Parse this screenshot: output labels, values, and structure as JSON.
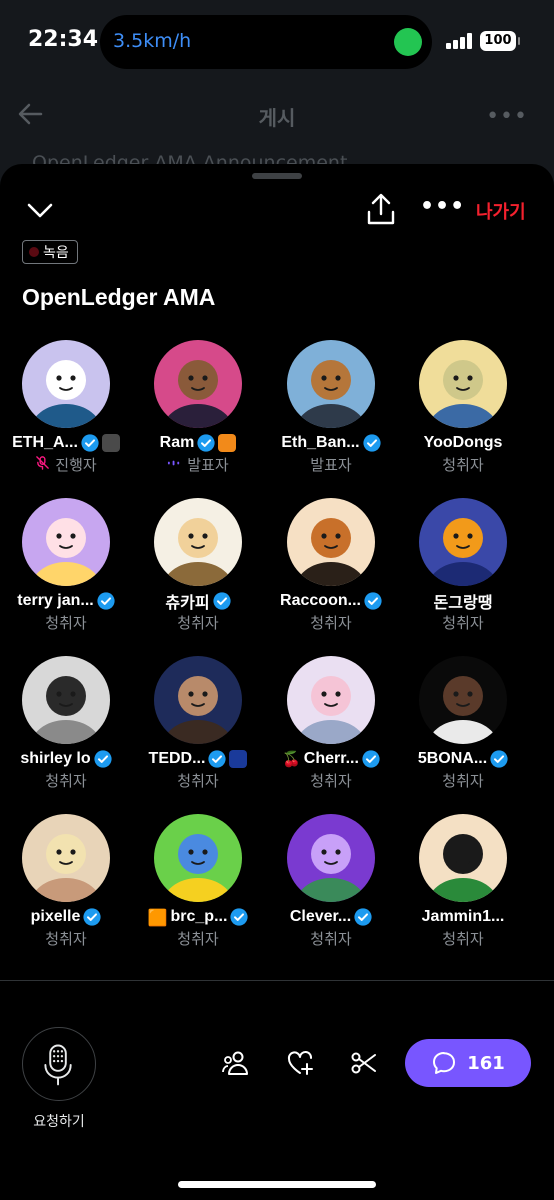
{
  "status_bar": {
    "time": "22:34",
    "speed": "3.5km/h",
    "battery": "100"
  },
  "background_page": {
    "title": "게시",
    "snippet": "OpenLedger AMA Announcement"
  },
  "header": {
    "leave_label": "나가기"
  },
  "space": {
    "recording_label": "녹음",
    "title": "OpenLedger AMA"
  },
  "participants": [
    {
      "name": "ETH_A...",
      "role": "진행자",
      "verified": true,
      "avatar_icon": "penguin-avatar-icon",
      "colors": [
        "#c9c3ee",
        "#ffffff",
        "#1f5a8a"
      ]
    },
    {
      "name": "Ram",
      "role": "발표자",
      "verified": true,
      "avatar_icon": "man-portrait-avatar-icon",
      "colors": [
        "#d64a8a",
        "#8a5a3a",
        "#2a1f3a"
      ]
    },
    {
      "name": "Eth_Ban...",
      "role": "발표자",
      "verified": true,
      "avatar_icon": "bear-king-avatar-icon",
      "colors": [
        "#7fb0d8",
        "#b5763a",
        "#2e3a4a"
      ]
    },
    {
      "name": "YooDongs",
      "role": "청취자",
      "verified": false,
      "avatar_icon": "yoodongs-nft-avatar-icon",
      "colors": [
        "#f0dd9a",
        "#cfc88a",
        "#3b6aa5"
      ]
    },
    {
      "name": "terry jan...",
      "role": "청취자",
      "verified": true,
      "avatar_icon": "cartoon-boy-avatar-icon",
      "colors": [
        "#c7a6f0",
        "#ffe0e6",
        "#ffd56a"
      ]
    },
    {
      "name": "츄카피",
      "role": "청취자",
      "verified": true,
      "avatar_icon": "powerpuff-girl-avatar-icon",
      "colors": [
        "#f5f0e4",
        "#f1d19a",
        "#8b6a3a"
      ]
    },
    {
      "name": "Raccoon...",
      "role": "청취자",
      "verified": true,
      "avatar_icon": "raccoon-avatar-icon",
      "colors": [
        "#f6e0c4",
        "#c8702a",
        "#2a2018"
      ]
    },
    {
      "name": "돈그랑땡",
      "role": "청취자",
      "verified": false,
      "avatar_icon": "orange-blob-avatar-icon",
      "colors": [
        "#3a48a8",
        "#f29a1a",
        "#1c2a74"
      ]
    },
    {
      "name": "shirley lo",
      "role": "청취자",
      "verified": true,
      "avatar_icon": "woman-photo-avatar-icon",
      "colors": [
        "#d8d8d8",
        "#2a2a2a",
        "#8a8a8a"
      ]
    },
    {
      "name": "TEDD...",
      "role": "청취자",
      "verified": true,
      "avatar_icon": "group-photo-avatar-icon",
      "colors": [
        "#1e2b5a",
        "#b88a6a",
        "#3a2a22"
      ]
    },
    {
      "name": "Cherr...",
      "role": "청취자",
      "verified": true,
      "avatar_icon": "anime-girl-avatar-icon",
      "colors": [
        "#eadff2",
        "#f5c4d6",
        "#9aa8c8"
      ]
    },
    {
      "name": "5BONA...",
      "role": "청취자",
      "verified": true,
      "avatar_icon": "dark-mask-avatar-icon",
      "colors": [
        "#0a0a0a",
        "#5a3a2a",
        "#eaeaea"
      ]
    },
    {
      "name": "pixelle",
      "role": "청취자",
      "verified": true,
      "avatar_icon": "blonde-woman-avatar-icon",
      "colors": [
        "#e8d4b8",
        "#f2e2b0",
        "#c89a7a"
      ]
    },
    {
      "name": "brc_p...",
      "role": "청취자",
      "verified": true,
      "avatar_icon": "sunglasses-kid-avatar-icon",
      "colors": [
        "#6ad04a",
        "#4a8ae0",
        "#f5d020"
      ]
    },
    {
      "name": "Clever...",
      "role": "청취자",
      "verified": true,
      "avatar_icon": "pixel-robot-avatar-icon",
      "colors": [
        "#7a3ad0",
        "#c8a0f8",
        "#3a8a5a"
      ]
    },
    {
      "name": "Jammin1...",
      "role": "청취자",
      "verified": false,
      "avatar_icon": "penguin-scarf-avatar-icon",
      "colors": [
        "#f4e0c4",
        "#1a1a1a",
        "#2a8a3a"
      ]
    }
  ],
  "participant_badges": {
    "host_icon": "mic-off-icon",
    "speaker_icon": "sound-wave-icon",
    "cherry_emoji": "🍒",
    "orange_square": "🟧"
  },
  "bottom_bar": {
    "request_label": "요청하기",
    "comment_count": "161"
  },
  "colors": {
    "accent_purple": "#7856ff",
    "verified_blue": "#1d9bf0",
    "leave_red": "#f4212e",
    "host_pink": "#f91880"
  }
}
